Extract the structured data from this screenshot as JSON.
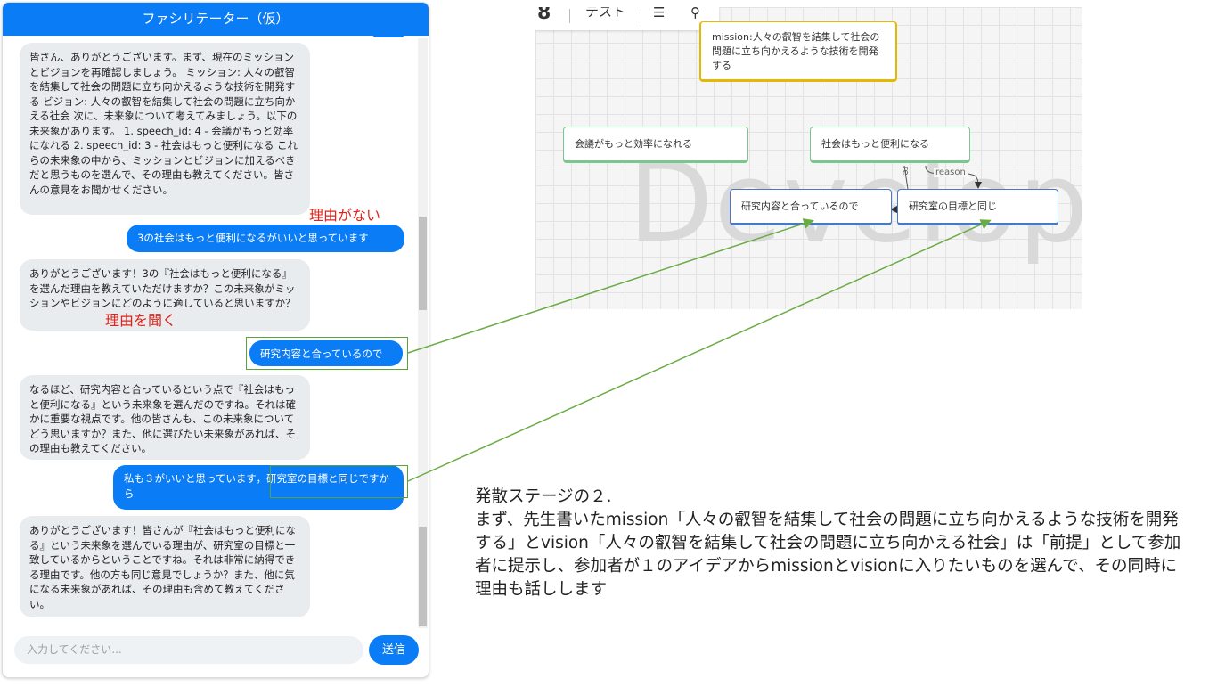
{
  "chat": {
    "title": "ファシリテーター（仮）",
    "messages": [
      {
        "role": "bot",
        "text": "皆さん、ありがとうございます。まず、現在のミッションとビジョンを再確認しましょう。 ミッション: 人々の叡智を結集して社会の問題に立ち向かえるような技術を開発する ビジョン: 人々の叡智を結集して社会の問題に立ち向かえる社会 次に、未来象について考えてみましょう。以下の未来象があります。 1. speech_id: 4 - 会議がもっと効率になれる 2. speech_id: 3 - 社会はもっと便利になる これらの未来象の中から、ミッションとビジョンに加えるべきだと思うものを選んで、その理由も教えてください。皆さんの意見をお聞かせください。"
      },
      {
        "role": "user",
        "text": "3の社会はもっと便利になるがいいと思っています"
      },
      {
        "role": "bot",
        "text": "ありがとうございます！3の『社会はもっと便利になる』を選んだ理由を教えていただけますか？この未来象がミッションやビジョンにどのように適していると思いますか？"
      },
      {
        "role": "user",
        "text": "研究内容と合っているので"
      },
      {
        "role": "bot",
        "text": "なるほど、研究内容と合っているという点で『社会はもっと便利になる』という未来象を選んだのですね。それは確かに重要な視点です。他の皆さんも、この未来象についてどう思いますか？また、他に選びたい未来象があれば、その理由も教えてください。"
      },
      {
        "role": "user",
        "text": "私も３がいいと思っています，研究室の目標と同じですから"
      },
      {
        "role": "bot",
        "text": "ありがとうございます！皆さんが『社会はもっと便利になる』という未来象を選んでいる理由が、研究室の目標と一致しているからということですね。それは非常に納得できる理由です。他の方も同じ意見でしょうか？また、他に気になる未来象があれば、その理由も含めて教えてください。"
      }
    ],
    "input_placeholder": "入力してください...",
    "send_label": "送信"
  },
  "annotations": {
    "no_reason": "理由がない",
    "ask_reason": "理由を聞く"
  },
  "diagram": {
    "toolbar": {
      "logo": "8",
      "title": "テスト",
      "menu_icon": "hamburger-menu-icon",
      "search_icon": "search-icon"
    },
    "watermark": "Develop",
    "nodes": {
      "mission": "mission:人々の叡智を結集して社会の問題に立ち向かえるような技術を開発する",
      "meeting": "会議がもっと効率になれる",
      "society": "社会はもっと便利になる",
      "research": "研究内容と合っているので",
      "lab": "研究室の目標と同じ"
    },
    "edge_labels": {
      "reason": "reason",
      "re": "re"
    }
  },
  "caption": {
    "line1": "発散ステージの２.",
    "body": "まず、先生書いたmission「人々の叡智を結集して社会の問題に立ち向かえるような技術を開発する」とvision「人々の叡智を結集して社会の問題に立ち向かえる社会」は「前提」として参加者に提示し、参加者が１のアイデアからmissionとvisionに入りたいものを選んで、その同時に理由も話しします"
  },
  "colors": {
    "accent": "#0a7cf5",
    "annotation_red": "#e0241b",
    "arrow_green": "#6aac44"
  }
}
